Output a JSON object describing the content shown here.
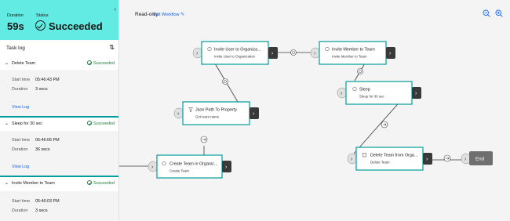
{
  "summary": {
    "duration_label": "Duration",
    "duration_value": "59s",
    "status_label": "Status",
    "status_value": "Succeeded"
  },
  "task_log": {
    "title": "Task log",
    "tasks": [
      {
        "name": "Delete Team",
        "status": "Succeeded",
        "start_label": "Start time",
        "start_value": "05:46:43 PM",
        "duration_label": "Duration",
        "duration_value": "3 secs",
        "view_log": "View Log"
      },
      {
        "name": "Sleep for 30 sec",
        "status": "Succeeded",
        "start_label": "Start time",
        "start_value": "05:46:06 PM",
        "duration_label": "Duration",
        "duration_value": "36 secs",
        "view_log": "View Log"
      },
      {
        "name": "Invite Member to Team",
        "status": "Succeeded",
        "start_label": "Start time",
        "start_value": "05:46:03 PM",
        "duration_label": "Duration",
        "duration_value": "3 secs"
      }
    ]
  },
  "toolbar": {
    "mode": "Read-only",
    "edit_label": "Edit Workflow"
  },
  "nodes": {
    "invite_user": {
      "title": "Invite User to Organiza...",
      "subtitle": "Invite User to Organization"
    },
    "invite_member": {
      "title": "Invite Member to Team",
      "subtitle": "Invite Member to Team"
    },
    "sleep": {
      "title": "Sleep",
      "subtitle": "Sleep for 30 sec"
    },
    "json_path": {
      "title": "Json Path To Property",
      "subtitle": "Get team name"
    },
    "create_team": {
      "title": "Create Team in Organiz...",
      "subtitle": "Create Team"
    },
    "delete_team": {
      "title": "Delete Team from Orga...",
      "subtitle": "Delete Team"
    },
    "end": {
      "label": "End"
    }
  },
  "colors": {
    "accent": "#009d9a",
    "summary_bg": "#62ebe2",
    "success": "#198038",
    "link": "#0f62fe",
    "node_dark": "#393939"
  }
}
